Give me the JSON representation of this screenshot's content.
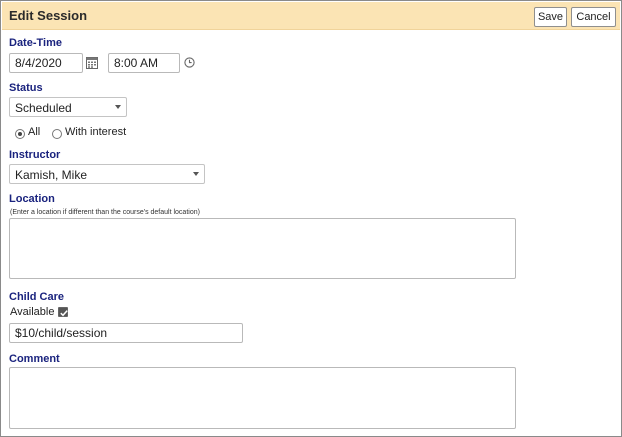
{
  "dialog": {
    "title": "Edit Session",
    "save_label": "Save",
    "cancel_label": "Cancel"
  },
  "datetime": {
    "label": "Date-Time",
    "date_value": "8/4/2020",
    "time_value": "8:00 AM",
    "calendar_icon": "calendar-icon",
    "clock_icon": "clock-icon"
  },
  "status": {
    "label": "Status",
    "selected": "Scheduled",
    "radio_all": "All",
    "radio_interest": "With interest",
    "selected_radio": "All"
  },
  "instructor": {
    "label": "Instructor",
    "selected": "Kamish, Mike"
  },
  "location": {
    "label": "Location",
    "hint": "(Enter a location if different than the course's default location)",
    "value": ""
  },
  "childcare": {
    "label": "Child Care",
    "available_label": "Available",
    "available_checked": true,
    "cost_value": "$10/child/session"
  },
  "comment": {
    "label": "Comment",
    "value": ""
  },
  "colors": {
    "header_bg": "#fbe4b4",
    "label_color": "#1a237e"
  }
}
